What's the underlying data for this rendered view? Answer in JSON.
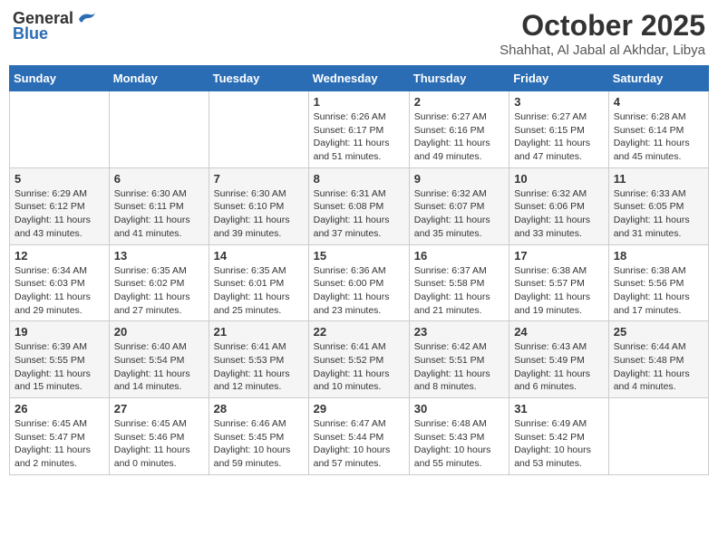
{
  "header": {
    "logo_general": "General",
    "logo_blue": "Blue",
    "month": "October 2025",
    "location": "Shahhat, Al Jabal al Akhdar, Libya"
  },
  "weekdays": [
    "Sunday",
    "Monday",
    "Tuesday",
    "Wednesday",
    "Thursday",
    "Friday",
    "Saturday"
  ],
  "weeks": [
    [
      {
        "day": "",
        "content": ""
      },
      {
        "day": "",
        "content": ""
      },
      {
        "day": "",
        "content": ""
      },
      {
        "day": "1",
        "content": "Sunrise: 6:26 AM\nSunset: 6:17 PM\nDaylight: 11 hours\nand 51 minutes."
      },
      {
        "day": "2",
        "content": "Sunrise: 6:27 AM\nSunset: 6:16 PM\nDaylight: 11 hours\nand 49 minutes."
      },
      {
        "day": "3",
        "content": "Sunrise: 6:27 AM\nSunset: 6:15 PM\nDaylight: 11 hours\nand 47 minutes."
      },
      {
        "day": "4",
        "content": "Sunrise: 6:28 AM\nSunset: 6:14 PM\nDaylight: 11 hours\nand 45 minutes."
      }
    ],
    [
      {
        "day": "5",
        "content": "Sunrise: 6:29 AM\nSunset: 6:12 PM\nDaylight: 11 hours\nand 43 minutes."
      },
      {
        "day": "6",
        "content": "Sunrise: 6:30 AM\nSunset: 6:11 PM\nDaylight: 11 hours\nand 41 minutes."
      },
      {
        "day": "7",
        "content": "Sunrise: 6:30 AM\nSunset: 6:10 PM\nDaylight: 11 hours\nand 39 minutes."
      },
      {
        "day": "8",
        "content": "Sunrise: 6:31 AM\nSunset: 6:08 PM\nDaylight: 11 hours\nand 37 minutes."
      },
      {
        "day": "9",
        "content": "Sunrise: 6:32 AM\nSunset: 6:07 PM\nDaylight: 11 hours\nand 35 minutes."
      },
      {
        "day": "10",
        "content": "Sunrise: 6:32 AM\nSunset: 6:06 PM\nDaylight: 11 hours\nand 33 minutes."
      },
      {
        "day": "11",
        "content": "Sunrise: 6:33 AM\nSunset: 6:05 PM\nDaylight: 11 hours\nand 31 minutes."
      }
    ],
    [
      {
        "day": "12",
        "content": "Sunrise: 6:34 AM\nSunset: 6:03 PM\nDaylight: 11 hours\nand 29 minutes."
      },
      {
        "day": "13",
        "content": "Sunrise: 6:35 AM\nSunset: 6:02 PM\nDaylight: 11 hours\nand 27 minutes."
      },
      {
        "day": "14",
        "content": "Sunrise: 6:35 AM\nSunset: 6:01 PM\nDaylight: 11 hours\nand 25 minutes."
      },
      {
        "day": "15",
        "content": "Sunrise: 6:36 AM\nSunset: 6:00 PM\nDaylight: 11 hours\nand 23 minutes."
      },
      {
        "day": "16",
        "content": "Sunrise: 6:37 AM\nSunset: 5:58 PM\nDaylight: 11 hours\nand 21 minutes."
      },
      {
        "day": "17",
        "content": "Sunrise: 6:38 AM\nSunset: 5:57 PM\nDaylight: 11 hours\nand 19 minutes."
      },
      {
        "day": "18",
        "content": "Sunrise: 6:38 AM\nSunset: 5:56 PM\nDaylight: 11 hours\nand 17 minutes."
      }
    ],
    [
      {
        "day": "19",
        "content": "Sunrise: 6:39 AM\nSunset: 5:55 PM\nDaylight: 11 hours\nand 15 minutes."
      },
      {
        "day": "20",
        "content": "Sunrise: 6:40 AM\nSunset: 5:54 PM\nDaylight: 11 hours\nand 14 minutes."
      },
      {
        "day": "21",
        "content": "Sunrise: 6:41 AM\nSunset: 5:53 PM\nDaylight: 11 hours\nand 12 minutes."
      },
      {
        "day": "22",
        "content": "Sunrise: 6:41 AM\nSunset: 5:52 PM\nDaylight: 11 hours\nand 10 minutes."
      },
      {
        "day": "23",
        "content": "Sunrise: 6:42 AM\nSunset: 5:51 PM\nDaylight: 11 hours\nand 8 minutes."
      },
      {
        "day": "24",
        "content": "Sunrise: 6:43 AM\nSunset: 5:49 PM\nDaylight: 11 hours\nand 6 minutes."
      },
      {
        "day": "25",
        "content": "Sunrise: 6:44 AM\nSunset: 5:48 PM\nDaylight: 11 hours\nand 4 minutes."
      }
    ],
    [
      {
        "day": "26",
        "content": "Sunrise: 6:45 AM\nSunset: 5:47 PM\nDaylight: 11 hours\nand 2 minutes."
      },
      {
        "day": "27",
        "content": "Sunrise: 6:45 AM\nSunset: 5:46 PM\nDaylight: 11 hours\nand 0 minutes."
      },
      {
        "day": "28",
        "content": "Sunrise: 6:46 AM\nSunset: 5:45 PM\nDaylight: 10 hours\nand 59 minutes."
      },
      {
        "day": "29",
        "content": "Sunrise: 6:47 AM\nSunset: 5:44 PM\nDaylight: 10 hours\nand 57 minutes."
      },
      {
        "day": "30",
        "content": "Sunrise: 6:48 AM\nSunset: 5:43 PM\nDaylight: 10 hours\nand 55 minutes."
      },
      {
        "day": "31",
        "content": "Sunrise: 6:49 AM\nSunset: 5:42 PM\nDaylight: 10 hours\nand 53 minutes."
      },
      {
        "day": "",
        "content": ""
      }
    ]
  ]
}
